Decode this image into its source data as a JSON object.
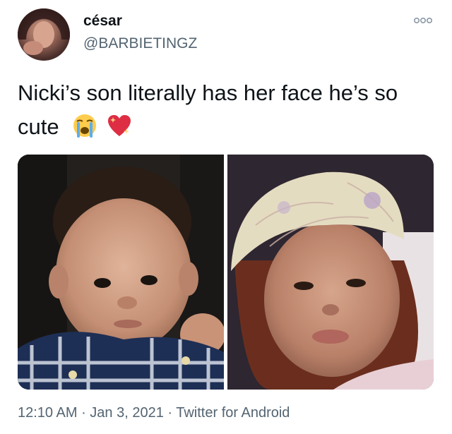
{
  "tweet": {
    "display_name": "césar",
    "handle": "@BARBIETINGZ",
    "text_line1": "Nicki’s son literally has her face he’s so",
    "text_line2": "cute",
    "emojis": [
      "loudly-crying-face-emoji",
      "sparkling-heart-emoji"
    ],
    "media": [
      {
        "icon": "baby-photo",
        "description_name": "baby-photo"
      },
      {
        "icon": "woman-selfie-photo",
        "description_name": "woman-selfie-photo"
      }
    ],
    "time": "12:10 AM",
    "separator1": " · ",
    "date": "Jan 3, 2021",
    "separator2": " · ",
    "source": "Twitter for Android"
  },
  "colors": {
    "text_primary": "#0f1419",
    "text_secondary": "#536471",
    "background": "#ffffff"
  },
  "icons": {
    "more": "more-options-icon"
  }
}
